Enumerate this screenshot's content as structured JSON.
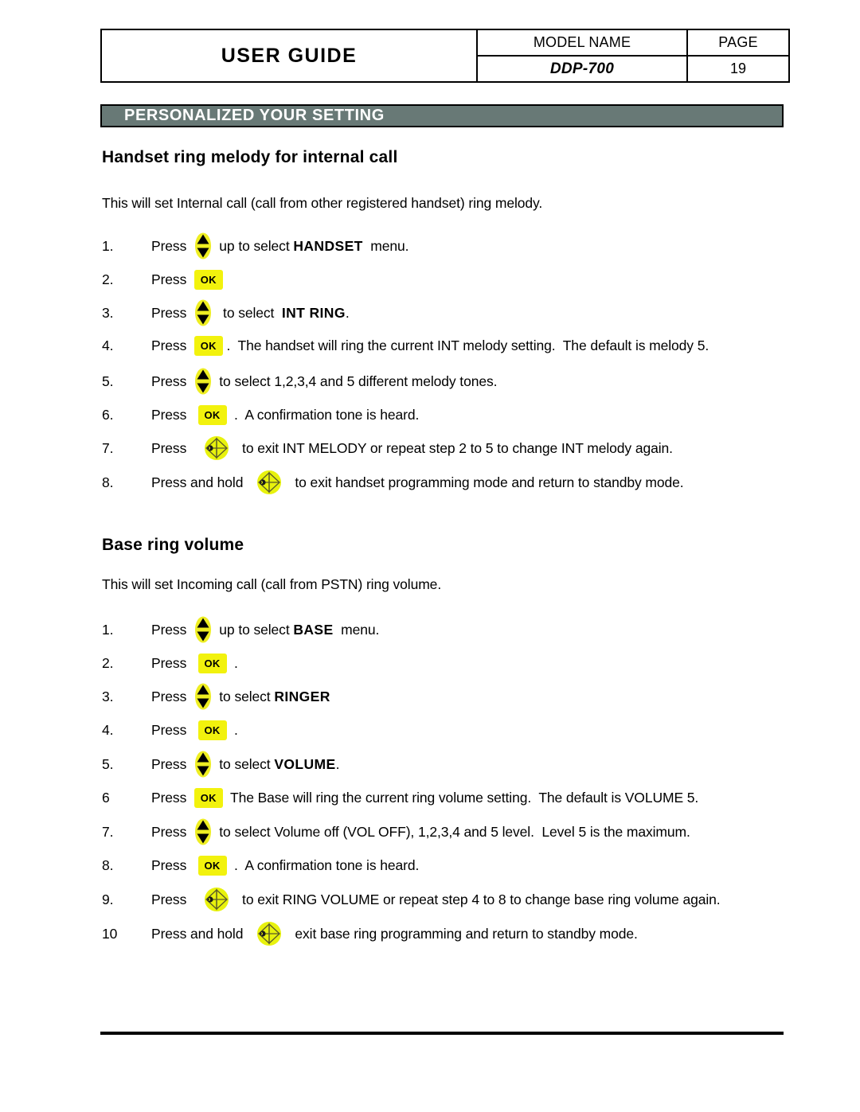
{
  "header": {
    "title": "USER GUIDE",
    "model_label": "MODEL NAME",
    "page_label": "PAGE",
    "model_value": "DDP-700",
    "page_value": "19"
  },
  "banner": {
    "title": "PERSONALIZED YOUR SETTING",
    "bg_color": "#687976",
    "text_color": "#ffffff"
  },
  "colors": {
    "icon_yellow": "#F2F20D",
    "icon_nav_yellow": "#EEEE22",
    "ink": "#000000"
  },
  "sections": [
    {
      "heading": "Handset ring melody for internal call",
      "intro": "This will set Internal call (call from other registered handset)  ring melody.",
      "steps": [
        {
          "num": "1.",
          "parts": [
            {
              "type": "text",
              "value": "Press  "
            },
            {
              "type": "icon",
              "name": "nav-updown-icon"
            },
            {
              "type": "text",
              "value": "  up to select "
            },
            {
              "type": "keyword",
              "value": "HANDSET"
            },
            {
              "type": "text",
              "value": "  menu."
            }
          ]
        },
        {
          "num": "2.",
          "parts": [
            {
              "type": "text",
              "value": "Press  "
            },
            {
              "type": "icon",
              "name": "ok-button-icon",
              "label": "OK"
            }
          ]
        },
        {
          "num": "3.",
          "parts": [
            {
              "type": "text",
              "value": "Press  "
            },
            {
              "type": "icon",
              "name": "nav-updown-icon"
            },
            {
              "type": "text",
              "value": "   to select  "
            },
            {
              "type": "keyword",
              "value": "INT RING"
            },
            {
              "type": "text",
              "value": "."
            }
          ]
        },
        {
          "num": "4.",
          "parts": [
            {
              "type": "text",
              "value": "Press  "
            },
            {
              "type": "icon",
              "name": "ok-button-icon",
              "label": "OK"
            },
            {
              "type": "text",
              "value": " .  The handset will ring the current INT melody setting.  The default is melody 5."
            }
          ]
        },
        {
          "num": "5.",
          "parts": [
            {
              "type": "text",
              "value": "Press  "
            },
            {
              "type": "icon",
              "name": "nav-updown-icon"
            },
            {
              "type": "text",
              "value": "  to select 1,2,3,4 and 5 different melody tones."
            }
          ]
        },
        {
          "num": "6.",
          "parts": [
            {
              "type": "text",
              "value": "Press   "
            },
            {
              "type": "icon",
              "name": "ok-button-icon",
              "label": "OK"
            },
            {
              "type": "text",
              "value": "  .  A confirmation tone is heard."
            }
          ]
        },
        {
          "num": "7.",
          "parts": [
            {
              "type": "text",
              "value": "Press   "
            },
            {
              "type": "icon",
              "name": "hangup-phone-icon"
            },
            {
              "type": "text",
              "value": "  to exit INT MELODY or repeat step 2 to 5 to change INT melody again."
            }
          ]
        },
        {
          "num": "8.",
          "parts": [
            {
              "type": "text",
              "value": "Press and hold  "
            },
            {
              "type": "icon",
              "name": "hangup-phone-icon"
            },
            {
              "type": "text",
              "value": "  to exit handset programming mode and return to standby mode."
            }
          ]
        }
      ]
    },
    {
      "heading": "Base ring volume",
      "intro": "This will set Incoming call (call from PSTN) ring volume.",
      "steps": [
        {
          "num": "1.",
          "parts": [
            {
              "type": "text",
              "value": "Press  "
            },
            {
              "type": "icon",
              "name": "nav-updown-icon"
            },
            {
              "type": "text",
              "value": "  up to select "
            },
            {
              "type": "keyword",
              "value": "BASE"
            },
            {
              "type": "text",
              "value": "  menu."
            }
          ]
        },
        {
          "num": "2.",
          "parts": [
            {
              "type": "text",
              "value": "Press   "
            },
            {
              "type": "icon",
              "name": "ok-button-icon",
              "label": "OK"
            },
            {
              "type": "text",
              "value": "  ."
            }
          ]
        },
        {
          "num": "3.",
          "parts": [
            {
              "type": "text",
              "value": "Press  "
            },
            {
              "type": "icon",
              "name": "nav-updown-icon"
            },
            {
              "type": "text",
              "value": "  to select "
            },
            {
              "type": "keyword",
              "value": "RINGER"
            }
          ]
        },
        {
          "num": "4.",
          "parts": [
            {
              "type": "text",
              "value": "Press   "
            },
            {
              "type": "icon",
              "name": "ok-button-icon",
              "label": "OK"
            },
            {
              "type": "text",
              "value": "  ."
            }
          ]
        },
        {
          "num": "5.",
          "parts": [
            {
              "type": "text",
              "value": "Press  "
            },
            {
              "type": "icon",
              "name": "nav-updown-icon"
            },
            {
              "type": "text",
              "value": "  to select "
            },
            {
              "type": "keyword",
              "value": "VOLUME"
            },
            {
              "type": "text",
              "value": "."
            }
          ]
        },
        {
          "num": "6",
          "parts": [
            {
              "type": "text",
              "value": "Press  "
            },
            {
              "type": "icon",
              "name": "ok-button-icon",
              "label": "OK"
            },
            {
              "type": "text",
              "value": "  The Base will ring the current ring volume setting.  The default is VOLUME 5."
            }
          ]
        },
        {
          "num": "7.",
          "parts": [
            {
              "type": "text",
              "value": "Press  "
            },
            {
              "type": "icon",
              "name": "nav-updown-icon"
            },
            {
              "type": "text",
              "value": "  to select Volume off (VOL OFF), 1,2,3,4 and 5 level.  Level 5 is the maximum."
            }
          ]
        },
        {
          "num": "8.",
          "parts": [
            {
              "type": "text",
              "value": "Press   "
            },
            {
              "type": "icon",
              "name": "ok-button-icon",
              "label": "OK"
            },
            {
              "type": "text",
              "value": "  .  A confirmation tone is heard."
            }
          ]
        },
        {
          "num": "9.",
          "parts": [
            {
              "type": "text",
              "value": "Press   "
            },
            {
              "type": "icon",
              "name": "hangup-phone-icon"
            },
            {
              "type": "text",
              "value": "  to exit RING VOLUME or repeat step 4 to 8 to change base ring volume again."
            }
          ]
        },
        {
          "num": "10",
          "parts": [
            {
              "type": "text",
              "value": "Press and hold  "
            },
            {
              "type": "icon",
              "name": "hangup-phone-icon"
            },
            {
              "type": "text",
              "value": "  exit base ring programming and return to standby mode."
            }
          ]
        }
      ]
    }
  ]
}
